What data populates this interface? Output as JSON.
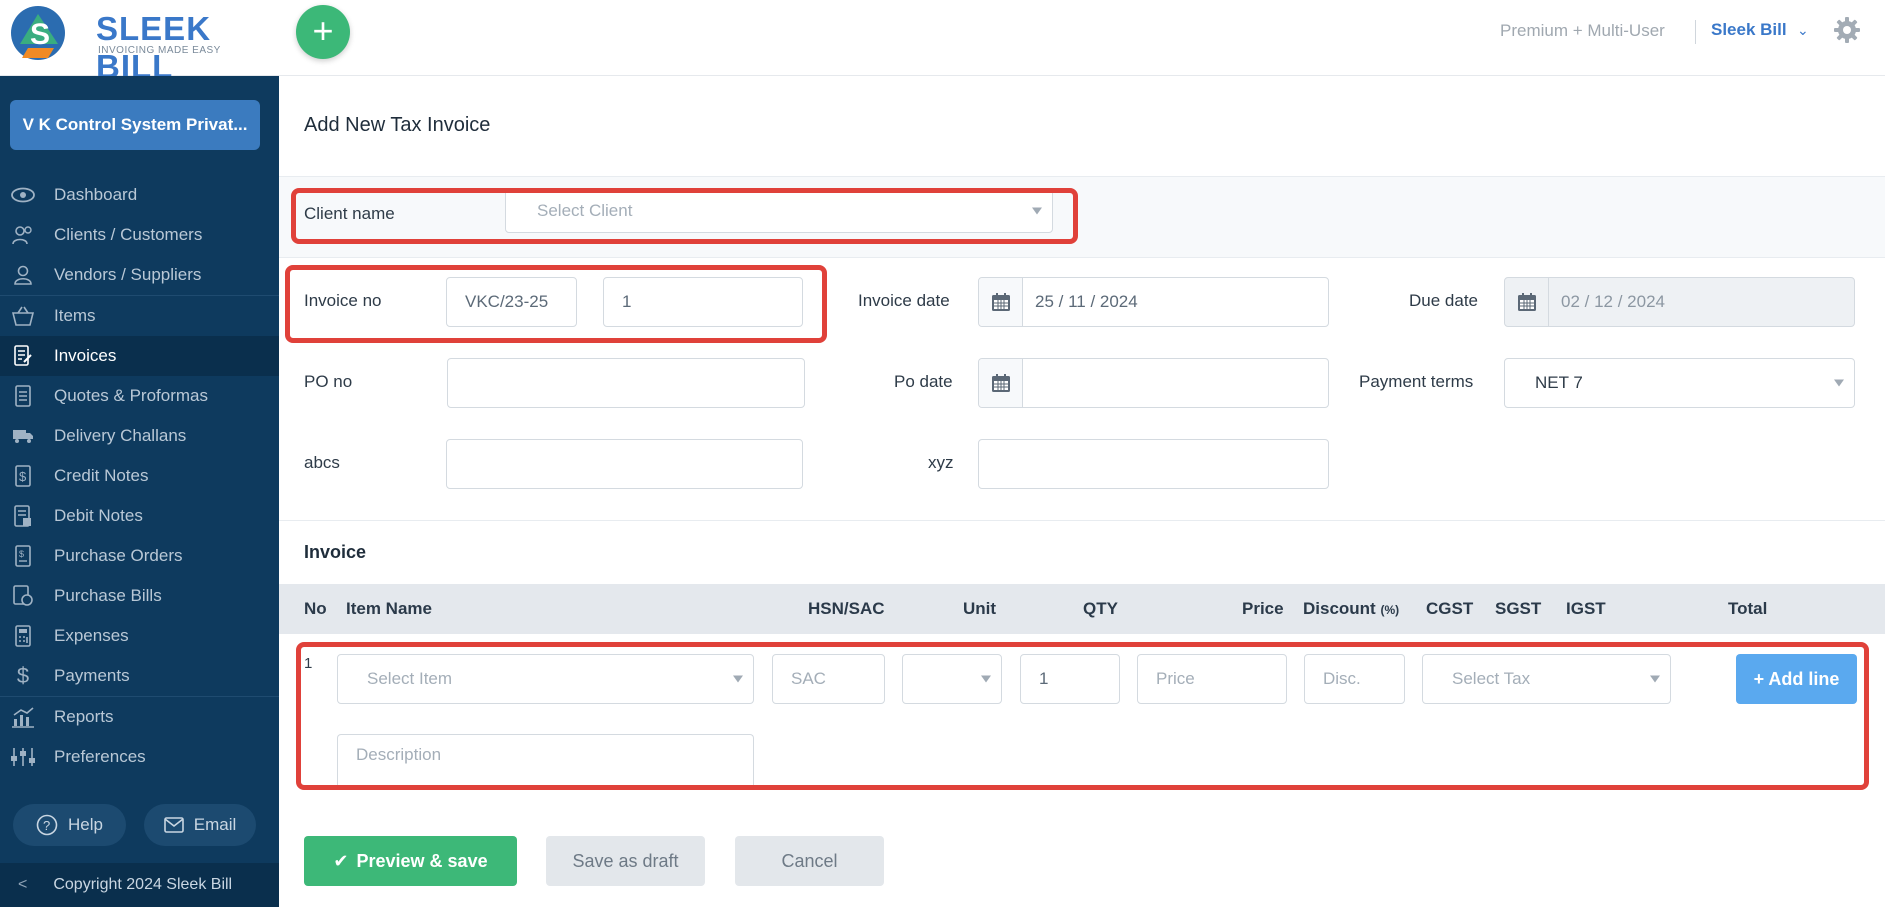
{
  "header": {
    "brand_title": "SLEEK BILL",
    "brand_tagline": "INVOICING MADE EASY",
    "plan_label": "Premium + Multi-User",
    "user_name": "Sleek Bill"
  },
  "sidebar": {
    "company_name": "V K Control System Privat...",
    "items": [
      {
        "label": "Dashboard",
        "icon": "eye-icon"
      },
      {
        "label": "Clients / Customers",
        "icon": "users-icon"
      },
      {
        "label": "Vendors / Suppliers",
        "icon": "vendor-icon"
      },
      {
        "label": "Items",
        "icon": "basket-icon"
      },
      {
        "label": "Invoices",
        "icon": "invoice-icon"
      },
      {
        "label": "Quotes & Proformas",
        "icon": "quote-icon"
      },
      {
        "label": "Delivery Challans",
        "icon": "truck-icon"
      },
      {
        "label": "Credit Notes",
        "icon": "credit-note-icon"
      },
      {
        "label": "Debit Notes",
        "icon": "debit-note-icon"
      },
      {
        "label": "Purchase Orders",
        "icon": "purchase-order-icon"
      },
      {
        "label": "Purchase Bills",
        "icon": "purchase-bill-icon"
      },
      {
        "label": "Expenses",
        "icon": "calculator-icon"
      },
      {
        "label": "Payments",
        "icon": "dollar-icon"
      },
      {
        "label": "Reports",
        "icon": "chart-icon"
      },
      {
        "label": "Preferences",
        "icon": "sliders-icon"
      }
    ],
    "active_item": "Invoices",
    "help_label": "Help",
    "email_label": "Email",
    "copyright": "Copyright 2024 Sleek Bill"
  },
  "form": {
    "title": "Add New Tax Invoice",
    "client_label": "Client name",
    "client_placeholder": "Select Client",
    "invoice_no_label": "Invoice no",
    "invoice_prefix": "VKC/23-25",
    "invoice_number": "1",
    "invoice_date_label": "Invoice date",
    "invoice_date": "25 / 11 / 2024",
    "due_date_label": "Due date",
    "due_date": "02 / 12 / 2024",
    "po_no_label": "PO no",
    "po_no": "",
    "po_date_label": "Po date",
    "po_date": "",
    "payment_terms_label": "Payment terms",
    "payment_terms": "NET 7",
    "custom1_label": "abcs",
    "custom1_value": "",
    "custom2_label": "xyz",
    "custom2_value": ""
  },
  "items_table": {
    "section_title": "Invoice",
    "columns": {
      "no": "No",
      "item_name": "Item Name",
      "hsn": "HSN/SAC",
      "unit": "Unit",
      "qty": "QTY",
      "price": "Price",
      "discount": "Discount",
      "discount_unit": "(%)",
      "cgst": "CGST",
      "sgst": "SGST",
      "igst": "IGST",
      "total": "Total"
    },
    "row": {
      "no": "1",
      "item_placeholder": "Select Item",
      "hsn_placeholder": "SAC",
      "unit": "",
      "qty": "1",
      "price_placeholder": "Price",
      "discount_placeholder": "Disc.",
      "tax_placeholder": "Select Tax",
      "description_placeholder": "Description"
    },
    "add_line_label": "+ Add line"
  },
  "actions": {
    "preview_save": "Preview & save",
    "save_draft": "Save as draft",
    "cancel": "Cancel"
  },
  "colors": {
    "sidebar_bg": "#0e3a5e",
    "accent_blue": "#3a78c9",
    "primary_green": "#3db878",
    "highlight_red": "#e0413a"
  }
}
